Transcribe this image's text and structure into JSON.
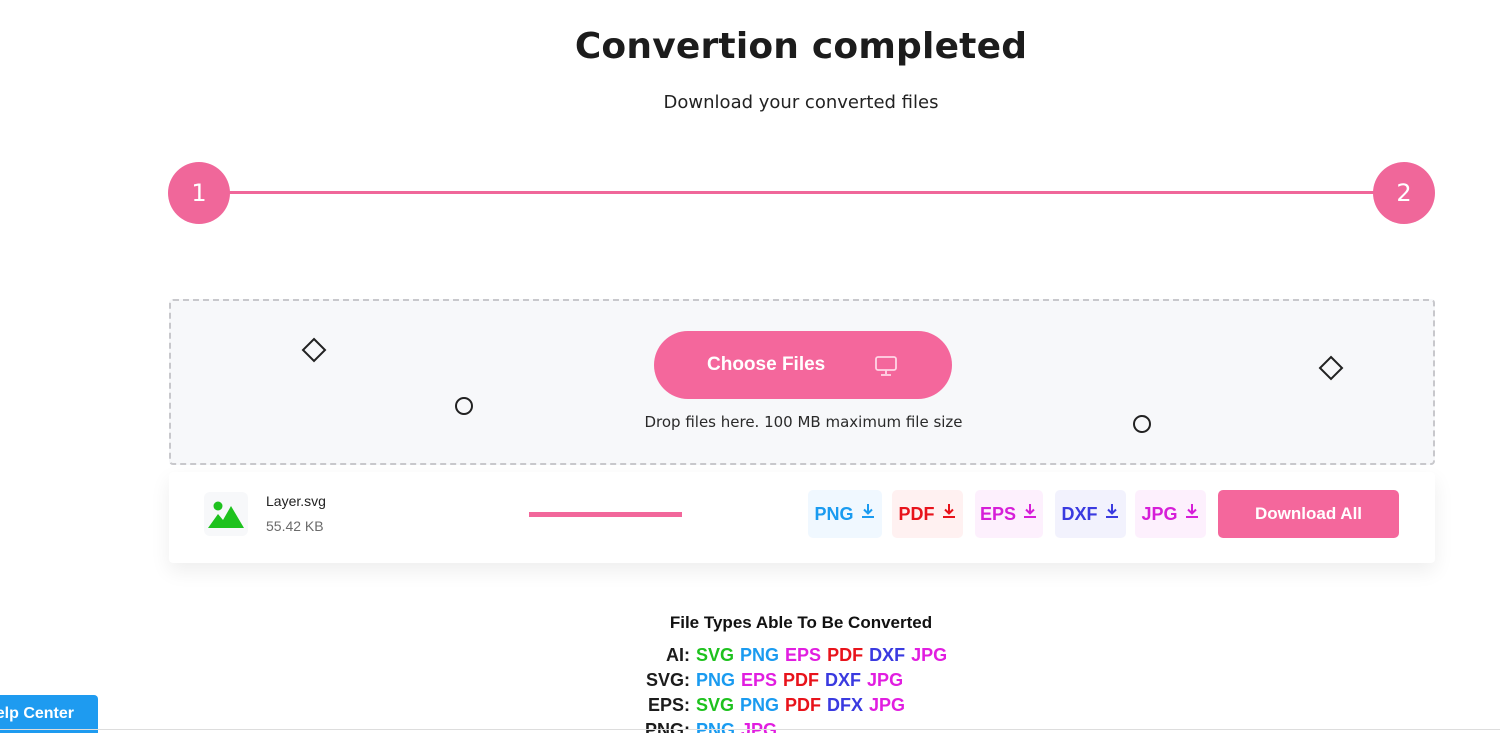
{
  "header": {
    "title": "Convertion completed",
    "subtitle": "Download your converted files"
  },
  "stepper": {
    "steps": [
      "1",
      "2"
    ],
    "accent": "#f0679a"
  },
  "dropzone": {
    "choose_label": "Choose Files",
    "choose_icon": "monitor-icon",
    "hint": "Drop files here. 100 MB maximum file size"
  },
  "file": {
    "icon": "image-icon",
    "name": "Layer.svg",
    "size": "55.42 KB",
    "progress_percent": 100
  },
  "formats": [
    {
      "label": "PNG",
      "color": "#1a9bf0",
      "bg": "#f0f8ff",
      "icon": "download-icon"
    },
    {
      "label": "PDF",
      "color": "#e8131b",
      "bg": "#fff1f1",
      "icon": "download-icon"
    },
    {
      "label": "EPS",
      "color": "#d61ed8",
      "bg": "#fdf0fd",
      "icon": "download-icon"
    },
    {
      "label": "DXF",
      "color": "#3a3ae0",
      "bg": "#f2f2fd",
      "icon": "download-icon"
    },
    {
      "label": "JPG",
      "color": "#d61ed8",
      "bg": "#fdf0fd",
      "icon": "download-icon"
    }
  ],
  "download_all_label": "Download All",
  "file_types": {
    "title": "File Types Able To Be Converted",
    "rows": [
      {
        "key": "AI:",
        "values": [
          {
            "t": "SVG",
            "c": "#1ec21e"
          },
          {
            "t": "PNG",
            "c": "#1a9bf0"
          },
          {
            "t": "EPS",
            "c": "#e11ee0"
          },
          {
            "t": "PDF",
            "c": "#e8131b"
          },
          {
            "t": "DXF",
            "c": "#3a3ae0"
          },
          {
            "t": "JPG",
            "c": "#e11ee0"
          }
        ]
      },
      {
        "key": "SVG:",
        "values": [
          {
            "t": "PNG",
            "c": "#1a9bf0"
          },
          {
            "t": "EPS",
            "c": "#e11ee0"
          },
          {
            "t": "PDF",
            "c": "#e8131b"
          },
          {
            "t": "DXF",
            "c": "#3a3ae0"
          },
          {
            "t": "JPG",
            "c": "#e11ee0"
          }
        ]
      },
      {
        "key": "EPS:",
        "values": [
          {
            "t": "SVG",
            "c": "#1ec21e"
          },
          {
            "t": "PNG",
            "c": "#1a9bf0"
          },
          {
            "t": "PDF",
            "c": "#e8131b"
          },
          {
            "t": "DFX",
            "c": "#3a3ae0"
          },
          {
            "t": "JPG",
            "c": "#e11ee0"
          }
        ]
      },
      {
        "key": "PNG:",
        "values": [
          {
            "t": "PNG",
            "c": "#1a9bf0"
          },
          {
            "t": "JPG",
            "c": "#e11ee0"
          }
        ]
      }
    ]
  },
  "help_center_label": "Help Center"
}
